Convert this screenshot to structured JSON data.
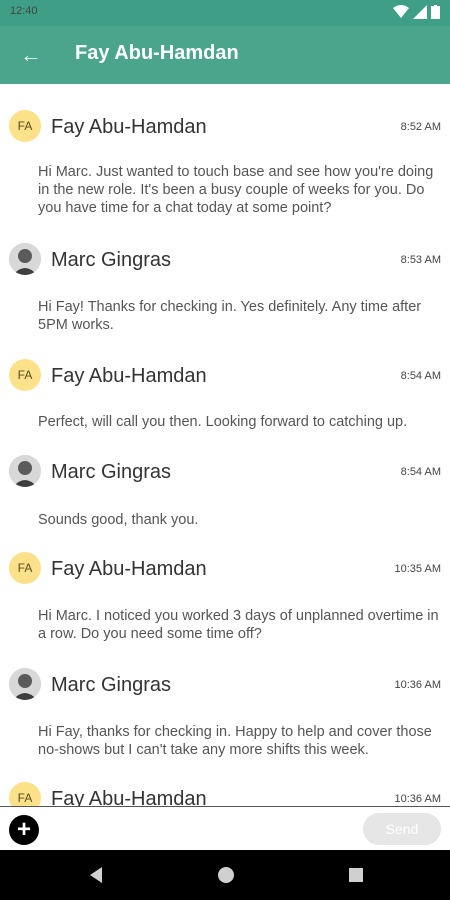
{
  "status": {
    "time": "12:40"
  },
  "header": {
    "title": "Fay Abu-Hamdan"
  },
  "messages": [
    {
      "sender": "Fay Abu-Hamdan",
      "initials": "FA",
      "time": "8:52 AM",
      "text": "Hi Marc. Just wanted to touch base and see how you're doing in the new role. It's been a busy couple of weeks for you. Do you have time for a chat today at some point?"
    },
    {
      "sender": "Marc Gingras",
      "time": "8:53 AM",
      "text": "Hi Fay! Thanks for checking in. Yes definitely. Any time after 5PM works."
    },
    {
      "sender": "Fay Abu-Hamdan",
      "initials": "FA",
      "time": "8:54 AM",
      "text": "Perfect, will call you then. Looking forward to catching up."
    },
    {
      "sender": "Marc Gingras",
      "time": "8:54 AM",
      "text": "Sounds good, thank you."
    },
    {
      "sender": "Fay Abu-Hamdan",
      "initials": "FA",
      "time": "10:35 AM",
      "text": "Hi Marc. I noticed you worked 3 days of unplanned overtime in a row. Do you need some time off?"
    },
    {
      "sender": "Marc Gingras",
      "time": "10:36 AM",
      "text": "Hi Fay, thanks for checking in. Happy to help and cover those no-shows but I can't take any more shifts this week."
    },
    {
      "sender": "Fay Abu-Hamdan",
      "initials": "FA",
      "time": "10:36 AM",
      "text": ""
    }
  ],
  "composer": {
    "send_label": "Send"
  },
  "colors": {
    "header": "#4aa58c",
    "status": "#3e9f86",
    "avatar_fa": "#fbe28a"
  }
}
